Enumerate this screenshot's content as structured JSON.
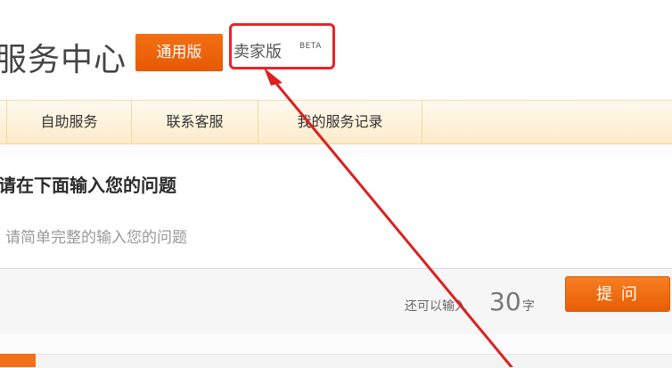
{
  "header": {
    "title": "服务中心",
    "general_tab": "通用版",
    "seller_tab": "卖家版",
    "beta_badge": "BETA"
  },
  "nav": {
    "items": [
      {
        "label": "自助服务"
      },
      {
        "label": "联系客服"
      },
      {
        "label": "我的服务记录"
      }
    ]
  },
  "question": {
    "title": "请在下面输入您的问题",
    "placeholder": "请简单完整的输入您的问题"
  },
  "footer": {
    "remaining_label": "还可以输入",
    "remaining_count": "30",
    "remaining_unit": "字",
    "submit_label": "提 问"
  },
  "colors": {
    "accent": "#f17019",
    "highlight": "#e8232a",
    "nav_bg": "#fdebc8"
  },
  "icons": {
    "annotation": "red-arrow-icon"
  }
}
